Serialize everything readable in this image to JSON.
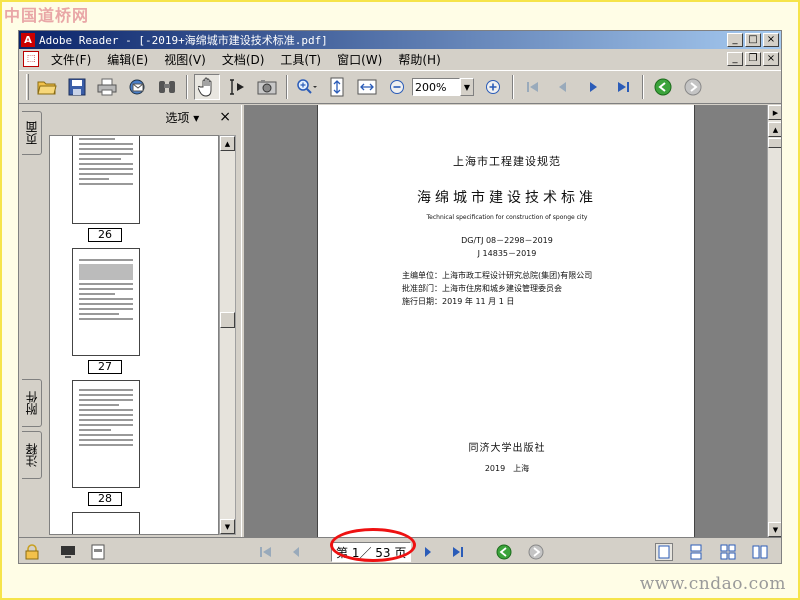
{
  "watermark": {
    "top": "中国道桥网",
    "bottom": "www.cndao.com"
  },
  "window": {
    "app_logo": "A",
    "title": "Adobe Reader - [-2019+海绵城市建设技术标准.pdf]",
    "buttons": {
      "minimize": "_",
      "maximize": "□",
      "close": "×"
    }
  },
  "menubar": {
    "items": [
      "文件(F)",
      "编辑(E)",
      "视图(V)",
      "文档(D)",
      "工具(T)",
      "窗口(W)",
      "帮助(H)"
    ],
    "doc_buttons": {
      "minimize": "_",
      "restore": "❐",
      "close": "×"
    }
  },
  "toolbar": {
    "icons": [
      "open-icon",
      "save-icon",
      "print-icon",
      "email-icon",
      "search-icon",
      "hand-icon",
      "select-text-icon",
      "snapshot-icon",
      "zoom-in-icon",
      "fit-page-icon",
      "fit-width-icon",
      "zoom-out-minus-icon",
      "zoom-in-plus-icon",
      "first-page-icon",
      "prev-page-icon",
      "next-page-icon",
      "last-page-icon",
      "back-icon",
      "forward-icon"
    ],
    "zoom": "200%"
  },
  "side_tabs": {
    "pages": "页面",
    "attachments": "附件",
    "comments": "注释"
  },
  "nav_pane": {
    "options_label": "选项 ▾",
    "close_label": "×",
    "thumbnails": [
      "26",
      "27",
      "28"
    ]
  },
  "document": {
    "org": "上海市工程建设规范",
    "title": "海绵城市建设技术标准",
    "title_en": "Technical specification for construction of sponge city",
    "code1": "DG/TJ 08－2298－2019",
    "code2": "J 14835－2019",
    "editor": "主编单位：上海市政工程设计研究总院(集团)有限公司",
    "approver": "批准部门：上海市住房和城乡建设管理委员会",
    "date": "施行日期：2019 年 11 月 1 日",
    "publisher": "同济大学出版社",
    "pub_year": "2019　上海"
  },
  "statusbar": {
    "page_indicator": "第 1／ 53 页"
  }
}
